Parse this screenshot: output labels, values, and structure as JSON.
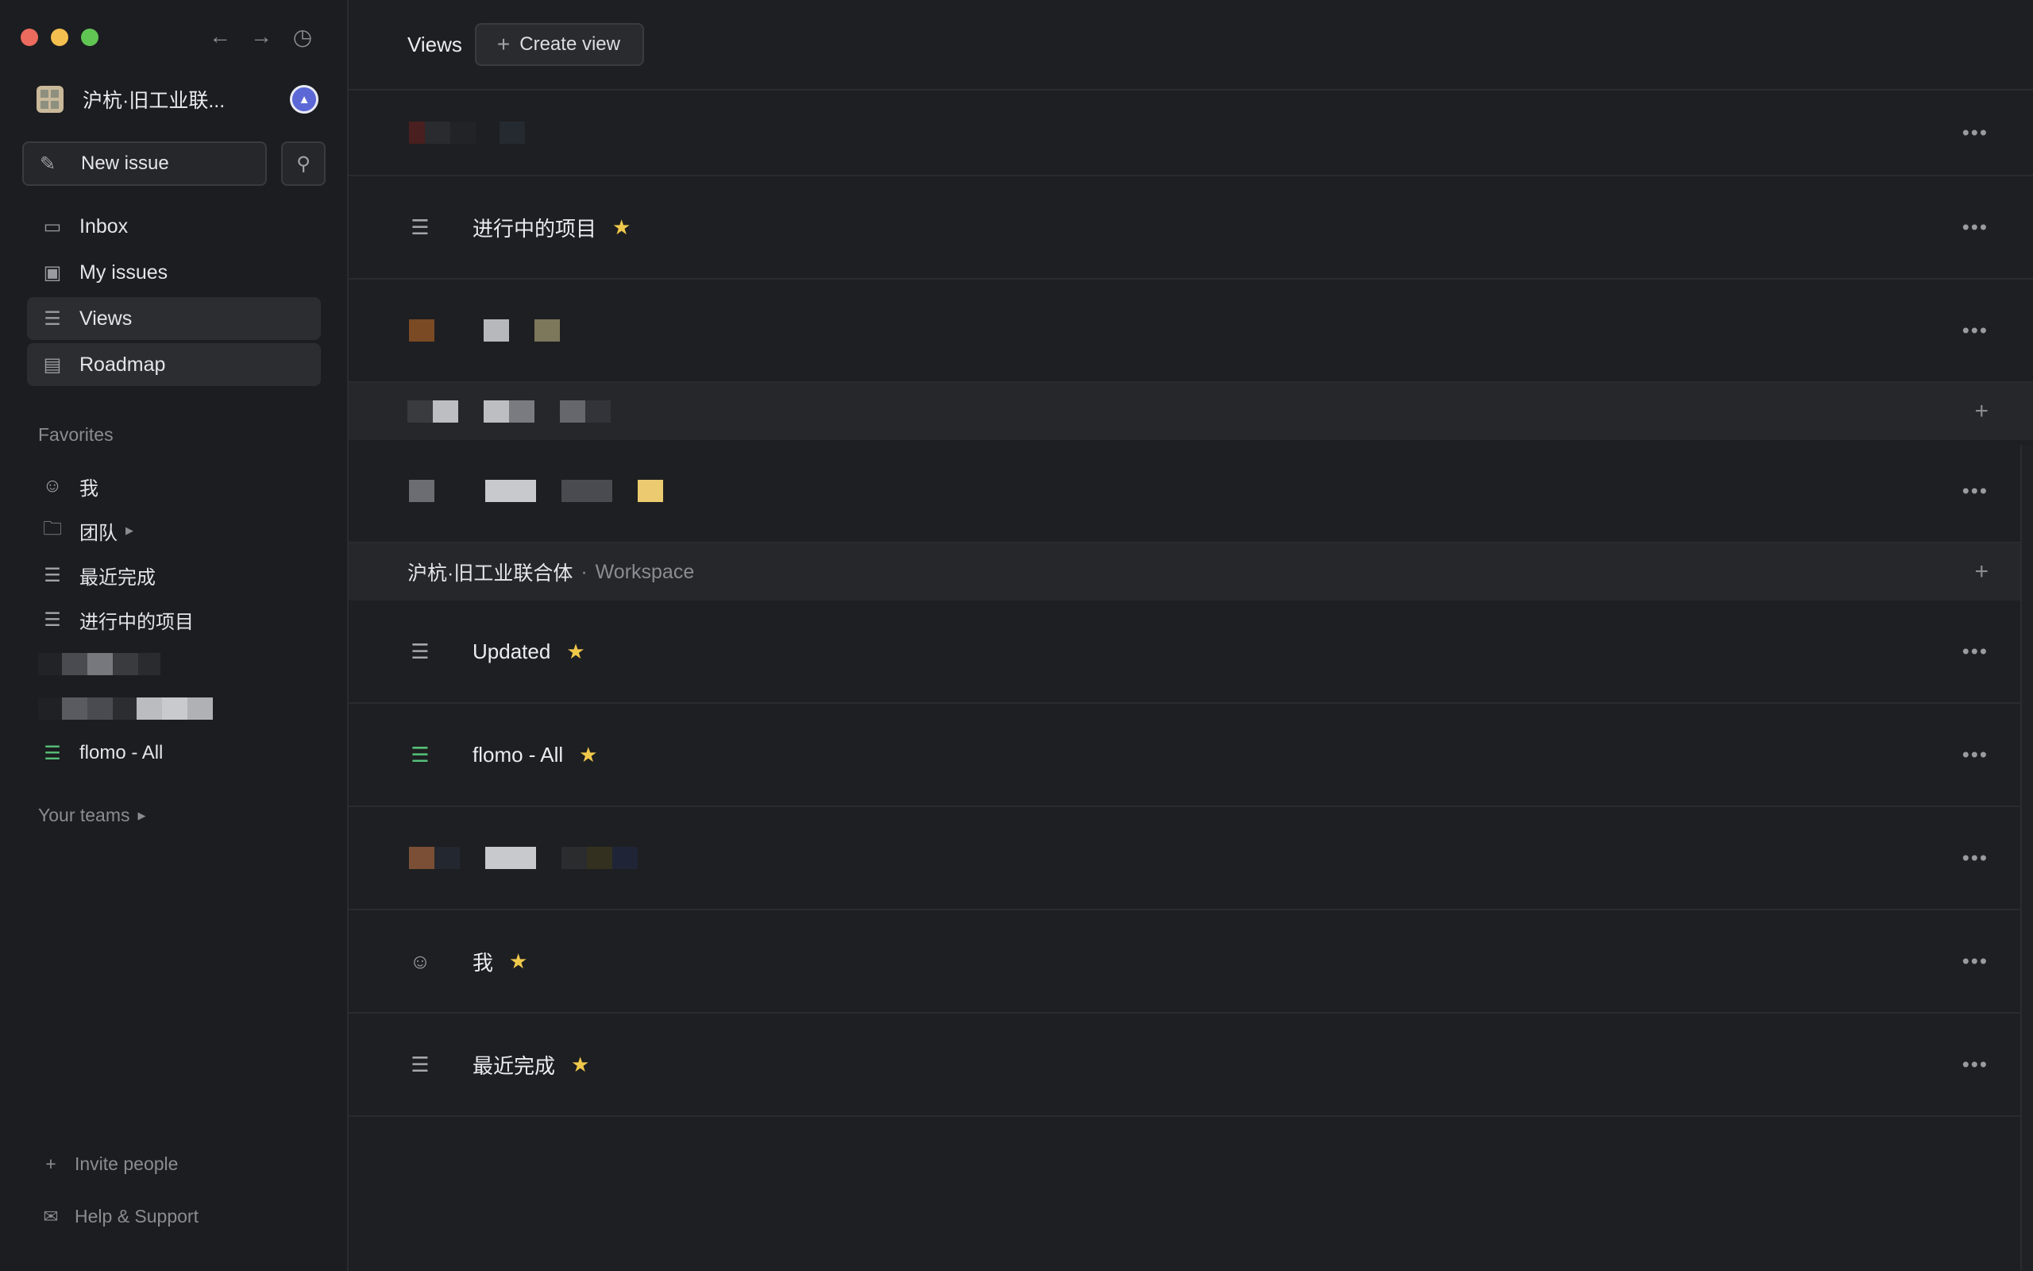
{
  "window": {
    "workspace_name": "沪杭·旧工业联..."
  },
  "sidebar": {
    "new_issue_label": "New issue",
    "nav": [
      {
        "label": "Inbox",
        "icon": "inbox-icon"
      },
      {
        "label": "My issues",
        "icon": "my-issues-icon"
      },
      {
        "label": "Views",
        "icon": "layers-icon"
      },
      {
        "label": "Roadmap",
        "icon": "map-icon"
      }
    ],
    "favorites_label": "Favorites",
    "favorites": [
      {
        "label": "我",
        "icon": "sunglasses-face-icon"
      },
      {
        "label": "团队",
        "icon": "folder-icon"
      },
      {
        "label": "最近完成",
        "icon": "stack-icon"
      },
      {
        "label": "进行中的项目",
        "icon": "layers-icon"
      },
      {
        "label": "flomo - All",
        "icon": "layers-icon"
      }
    ],
    "your_teams_label": "Your teams",
    "invite_label": "Invite people",
    "help_label": "Help & Support"
  },
  "main": {
    "title": "Views",
    "create_view_label": "Create view",
    "rows": [
      {
        "label": "进行中的项目",
        "starred": true
      },
      {
        "label": "Updated",
        "starred": true
      },
      {
        "label": "flomo - All",
        "starred": true
      },
      {
        "label": "我",
        "starred": true
      },
      {
        "label": "最近完成",
        "starred": true
      }
    ],
    "workspace_group": {
      "name": "沪杭·旧工业联合体",
      "separator": "·",
      "kind": "Workspace"
    }
  },
  "colors": {
    "accent_star": "#f0c94b",
    "flomo_green": "#57c07a",
    "background": "#1e1f22",
    "sidebar": "#1c1d20"
  }
}
